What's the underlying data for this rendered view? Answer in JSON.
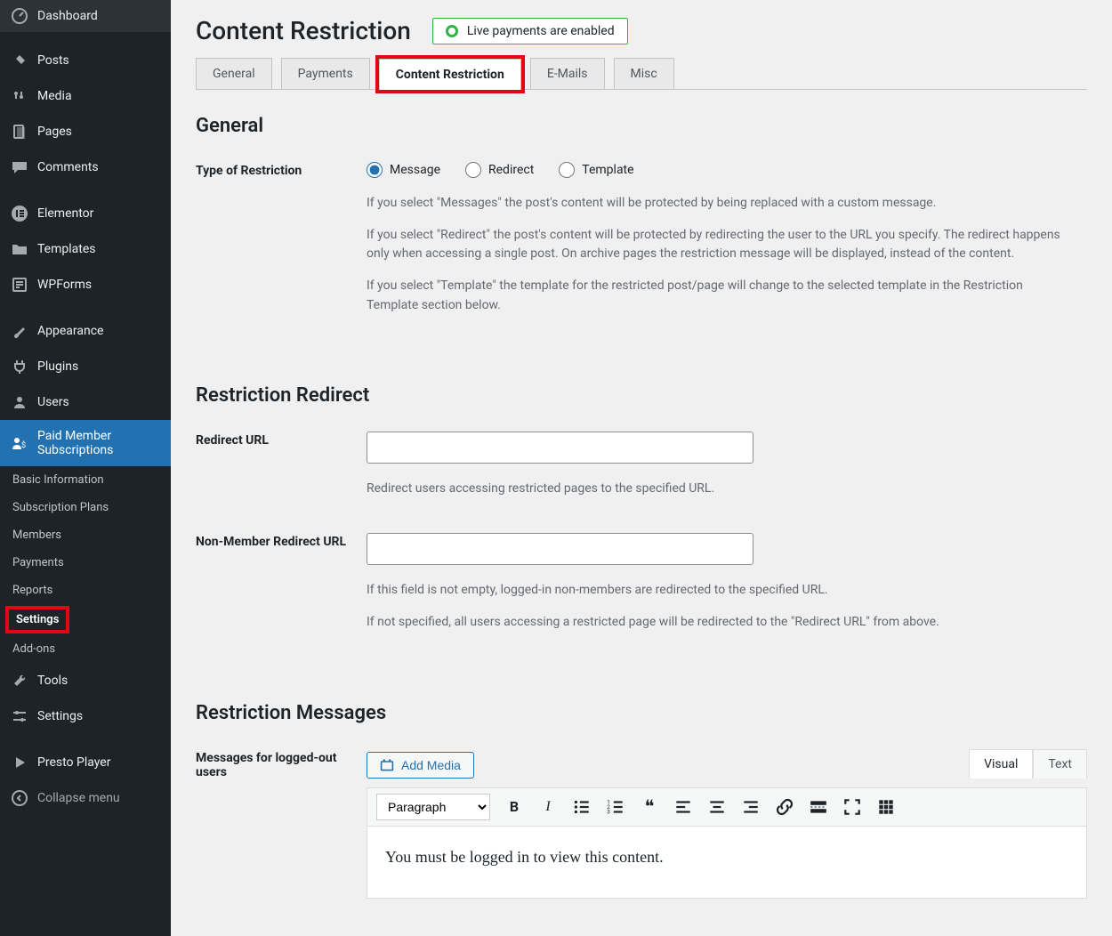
{
  "sidebar": {
    "items": [
      {
        "label": "Dashboard"
      },
      {
        "label": "Posts"
      },
      {
        "label": "Media"
      },
      {
        "label": "Pages"
      },
      {
        "label": "Comments"
      },
      {
        "label": "Elementor"
      },
      {
        "label": "Templates"
      },
      {
        "label": "WPForms"
      },
      {
        "label": "Appearance"
      },
      {
        "label": "Plugins"
      },
      {
        "label": "Users"
      },
      {
        "label": "Paid Member Subscriptions"
      },
      {
        "label": "Tools"
      },
      {
        "label": "Settings"
      },
      {
        "label": "Presto Player"
      },
      {
        "label": "Collapse menu"
      }
    ],
    "submenu": [
      {
        "label": "Basic Information"
      },
      {
        "label": "Subscription Plans"
      },
      {
        "label": "Members"
      },
      {
        "label": "Payments"
      },
      {
        "label": "Reports"
      },
      {
        "label": "Settings"
      },
      {
        "label": "Add-ons"
      }
    ]
  },
  "page": {
    "title": "Content Restriction",
    "status": "Live payments are enabled",
    "tabs": [
      "General",
      "Payments",
      "Content Restriction",
      "E-Mails",
      "Misc"
    ]
  },
  "general": {
    "heading": "General",
    "label_typeof": "Type of Restriction",
    "radios": [
      "Message",
      "Redirect",
      "Template"
    ],
    "desc1": "If you select \"Messages\" the post's content will be protected by being replaced with a custom message.",
    "desc2": "If you select \"Redirect\" the post's content will be protected by redirecting the user to the URL you specify. The redirect happens only when accessing a single post. On archive pages the restriction message will be displayed, instead of the content.",
    "desc3": "If you select \"Template\" the template for the restricted post/page will change to the selected template in the Restriction Template section below."
  },
  "redirect": {
    "heading": "Restriction Redirect",
    "label1": "Redirect URL",
    "desc1": "Redirect users accessing restricted pages to the specified URL.",
    "label2": "Non-Member Redirect URL",
    "desc2a": "If this field is not empty, logged-in non-members are redirected to the specified URL.",
    "desc2b": "If not specified, all users accessing a restricted page will be redirected to the \"Redirect URL\" from above."
  },
  "messages": {
    "heading": "Restriction Messages",
    "label1": "Messages for logged-out users",
    "add_media": "Add Media",
    "editor_tabs": [
      "Visual",
      "Text"
    ],
    "format": "Paragraph",
    "content": "You must be logged in to view this content."
  }
}
